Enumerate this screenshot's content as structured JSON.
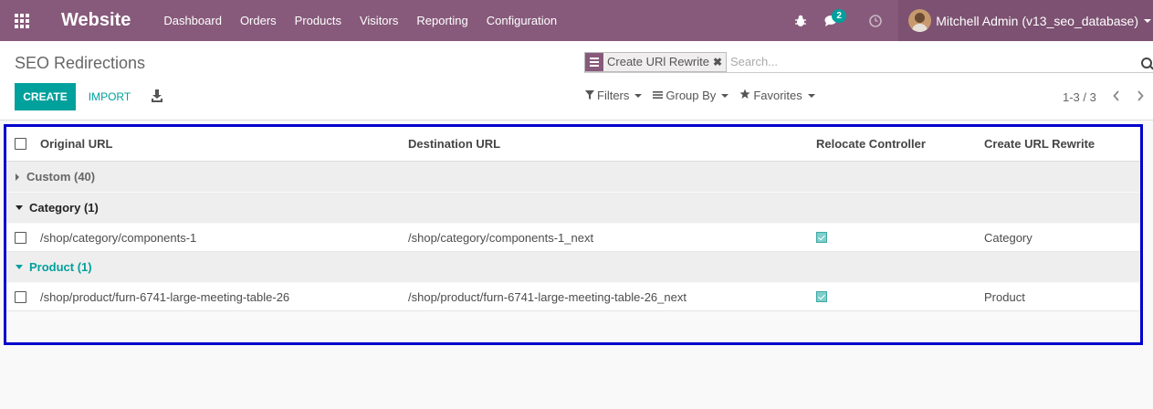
{
  "navbar": {
    "brand": "Website",
    "menu": [
      "Dashboard",
      "Orders",
      "Products",
      "Visitors",
      "Reporting",
      "Configuration"
    ],
    "messages_count": "2",
    "user_name": "Mitchell Admin (v13_seo_database)"
  },
  "control": {
    "breadcrumb": "SEO Redirections",
    "facet_value": "Create URl Rewrite",
    "facet_remove": "✖",
    "search_placeholder": "Search...",
    "create_label": "CREATE",
    "import_label": "IMPORT",
    "filters_label": "Filters",
    "groupby_label": "Group By",
    "favorites_label": "Favorites",
    "pager_value": "1-3 / 3"
  },
  "list": {
    "columns": {
      "original_url": "Original URL",
      "destination_url": "Destination URL",
      "relocate_controller": "Relocate Controller",
      "create_url_rewrite": "Create URL Rewrite"
    },
    "groups": [
      {
        "label": "Custom (40)",
        "expanded": false
      },
      {
        "label": "Category (1)",
        "expanded": true,
        "rows": [
          {
            "original": "/shop/category/components-1",
            "destination": "/shop/category/components-1_next",
            "relocate": true,
            "rewrite": "Category"
          }
        ]
      },
      {
        "label": "Product (1)",
        "expanded": true,
        "rows": [
          {
            "original": "/shop/product/furn-6741-large-meeting-table-26",
            "destination": "/shop/product/furn-6741-large-meeting-table-26_next",
            "relocate": true,
            "rewrite": "Product"
          }
        ]
      }
    ]
  },
  "colors": {
    "navbar": "#875a7b",
    "accent": "#00a09d",
    "highlight_border": "#0000cc"
  }
}
